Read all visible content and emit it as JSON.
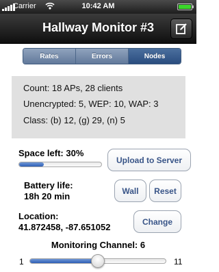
{
  "status_bar": {
    "carrier": "Carrier",
    "time": "10:42 AM"
  },
  "nav": {
    "title": "Hallway Monitor #3",
    "compose_icon": "compose-icon"
  },
  "tabs": {
    "items": [
      {
        "label": "Rates"
      },
      {
        "label": "Errors"
      },
      {
        "label": "Nodes"
      }
    ],
    "selected": "Nodes"
  },
  "info": {
    "count": "Count: 18 APs, 28 clients",
    "encryption": "Unencrypted: 5, WEP: 10, WAP: 3",
    "class": "Class: (b) 12, (g) 29, (n) 5"
  },
  "storage": {
    "label": "Space left: 30%",
    "percent": 30,
    "upload_button": "Upload to Server"
  },
  "battery": {
    "label_line1": "Battery life:",
    "label_line2": "18h 20 min",
    "wall_button": "Wall",
    "reset_button": "Reset"
  },
  "location": {
    "label_line1": "Location:",
    "label_line2": "41.872458, -87.651052",
    "change_button": "Change"
  },
  "channel": {
    "label": "Monitoring Channel: 6",
    "min": "1",
    "max": "11",
    "value": 6
  },
  "colors": {
    "accent": "#385487",
    "selected_segment": "#2a4d7f",
    "segment": "#7a8fad",
    "progress": "#2e5fb6"
  }
}
